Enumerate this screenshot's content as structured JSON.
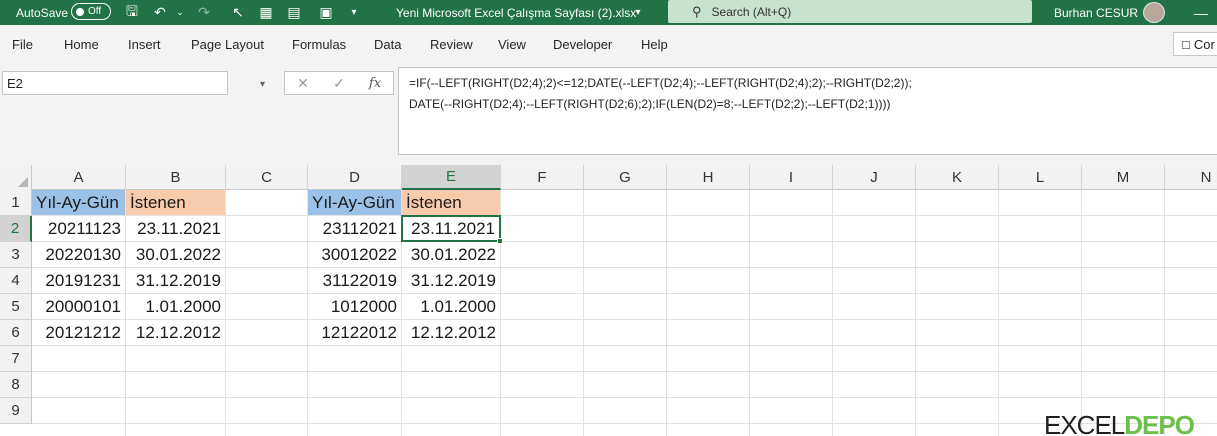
{
  "titlebar": {
    "autosave_label": "AutoSave",
    "autosave_state": "Off",
    "document_title": "Yeni Microsoft Excel Çalışma Sayfası (2).xlsx",
    "search_placeholder": "Search (Alt+Q)",
    "user_name": "Burhan CESUR",
    "accent_color": "#217346"
  },
  "menu": {
    "items": [
      "File",
      "Home",
      "Insert",
      "Page Layout",
      "Formulas",
      "Data",
      "Review",
      "View",
      "Developer",
      "Help"
    ],
    "comments_label": "Cor"
  },
  "formula_bar": {
    "name_box": "E2",
    "fx_label": "fx",
    "formula_line1": "=IF(--LEFT(RIGHT(D2;4);2)<=12;DATE(--LEFT(D2;4);--LEFT(RIGHT(D2;4);2);--RIGHT(D2;2));",
    "formula_line2": "DATE(--RIGHT(D2;4);--LEFT(RIGHT(D2;6);2);IF(LEN(D2)=8;--LEFT(D2;2);--LEFT(D2;1))))"
  },
  "sheet": {
    "columns": [
      "A",
      "B",
      "C",
      "D",
      "E",
      "F",
      "G",
      "H",
      "I",
      "J",
      "K",
      "L",
      "M",
      "N"
    ],
    "rows": [
      "1",
      "2",
      "3",
      "4",
      "5",
      "6",
      "7",
      "8",
      "9"
    ],
    "active_cell": "E2",
    "headers": {
      "A1": "Yıl-Ay-Gün",
      "B1": "İstenen",
      "D1": "Yıl-Ay-Gün",
      "E1": "İstenen"
    },
    "colA": [
      "20211123",
      "20220130",
      "20191231",
      "20000101",
      "20121212"
    ],
    "colB": [
      "23.11.2021",
      "30.01.2022",
      "31.12.2019",
      "1.01.2000",
      "12.12.2012"
    ],
    "colD": [
      "23112021",
      "30012022",
      "31122019",
      "1012000",
      "12122012"
    ],
    "colE": [
      "23.11.2021",
      "30.01.2022",
      "31.12.2019",
      "1.01.2000",
      "12.12.2012"
    ],
    "header_colors": {
      "blue": "#9bc2e6",
      "orange": "#f8cbad"
    }
  },
  "watermark": {
    "excel": "EXCEL",
    "depo": "DEPO"
  }
}
